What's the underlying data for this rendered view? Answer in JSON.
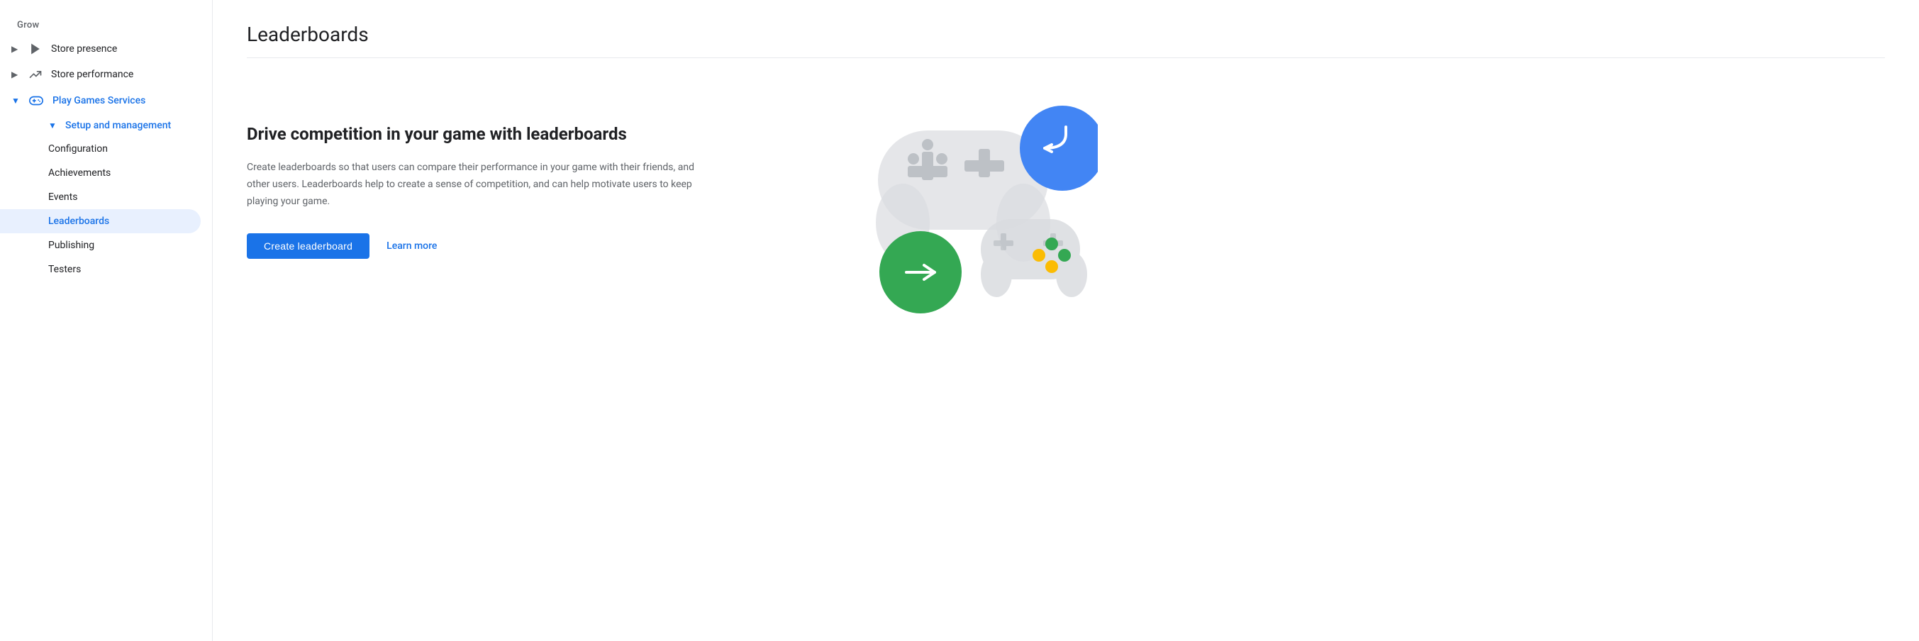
{
  "sidebar": {
    "section_label": "Grow",
    "items": [
      {
        "id": "store-presence",
        "label": "Store presence",
        "icon": "play-icon",
        "has_chevron": true,
        "chevron": "▶",
        "active": false,
        "blue": false
      },
      {
        "id": "store-performance",
        "label": "Store performance",
        "icon": "trending-icon",
        "has_chevron": true,
        "chevron": "▶",
        "active": false,
        "blue": false
      },
      {
        "id": "play-games-services",
        "label": "Play Games Services",
        "icon": "gamepad-icon",
        "has_chevron": true,
        "chevron": "▼",
        "active": true,
        "blue": true
      }
    ],
    "sub_section": {
      "label": "Setup and management",
      "chevron": "▼",
      "items": [
        {
          "id": "configuration",
          "label": "Configuration",
          "active": false
        },
        {
          "id": "achievements",
          "label": "Achievements",
          "active": false
        },
        {
          "id": "events",
          "label": "Events",
          "active": false
        },
        {
          "id": "leaderboards",
          "label": "Leaderboards",
          "active": true
        },
        {
          "id": "publishing",
          "label": "Publishing",
          "active": false
        },
        {
          "id": "testers",
          "label": "Testers",
          "active": false
        }
      ]
    }
  },
  "main": {
    "page_title": "Leaderboards",
    "content_heading": "Drive competition in your game with leaderboards",
    "content_description": "Create leaderboards so that users can compare their performance in your game with their friends, and other users. Leaderboards help to create a sense of competition, and can help motivate users to keep playing your game.",
    "create_button_label": "Create leaderboard",
    "learn_more_label": "Learn more"
  },
  "colors": {
    "primary": "#1a73e8",
    "active_bg": "#e8f0fe",
    "divider": "#e8eaed",
    "text_secondary": "#5f6368",
    "green": "#34a853",
    "blue": "#4285f4",
    "yellow": "#fbbc04",
    "controller_bg": "#dadce0"
  }
}
